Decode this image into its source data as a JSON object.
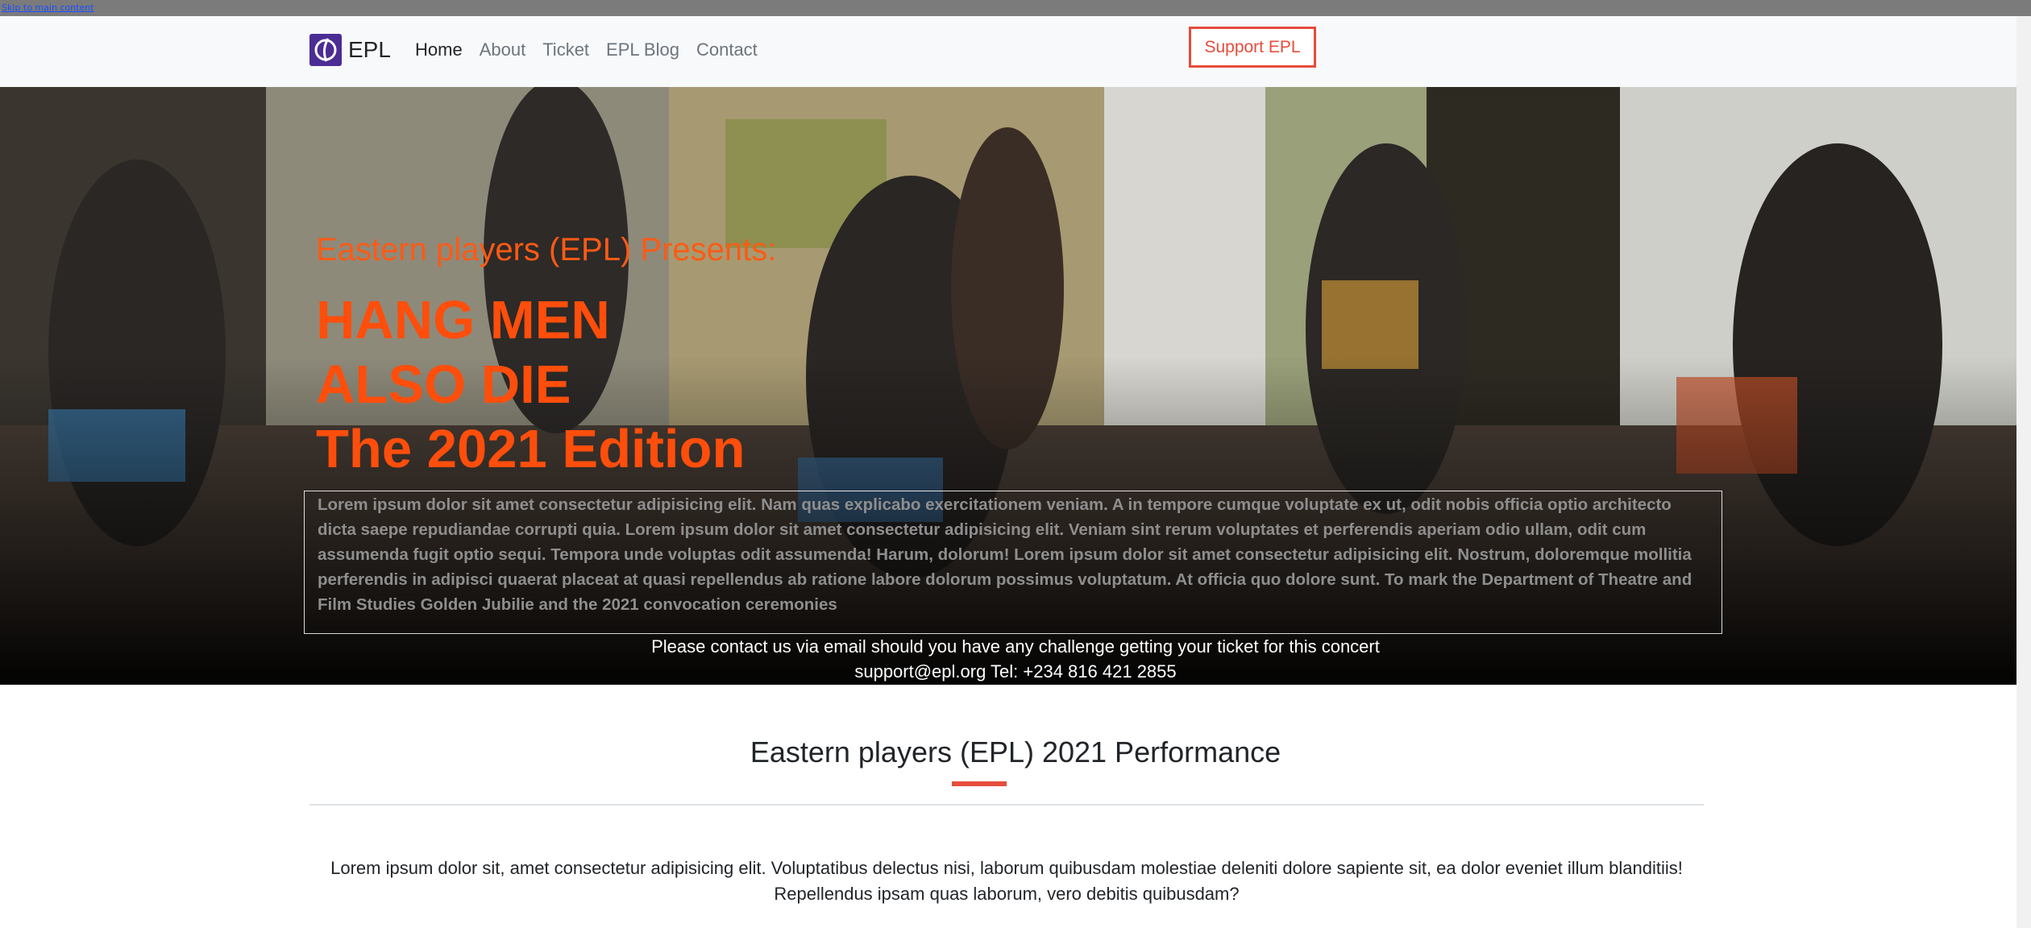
{
  "skip_link": "Skip to main content",
  "nav": {
    "brand": "EPL",
    "links": [
      "Home",
      "About",
      "Ticket",
      "EPL Blog",
      "Contact"
    ],
    "support_label": "Support EPL"
  },
  "hero": {
    "pretitle": "Eastern players (EPL) Presents:",
    "title_lines": [
      "HANG MEN",
      "ALSO DIE",
      "The 2021 Edition"
    ],
    "body": "Lorem ipsum dolor sit amet consectetur adipisicing elit. Nam quas explicabo exercitationem veniam. A in tempore cumque voluptate ex ut, odit nobis officia optio architecto dicta saepe repudiandae corrupti quia. Lorem ipsum dolor sit amet consectetur adipisicing elit. Veniam sint rerum voluptates et perferendis aperiam odio ullam, odit cum assumenda fugit optio sequi. Tempora unde voluptas odit assumenda! Harum, dolorum! Lorem ipsum dolor sit amet consectetur adipisicing elit. Nostrum, doloremque mollitia perferendis in adipisci quaerat placeat at quasi repellendus ab ratione labore dolorum possimus voluptatum. At officia quo dolore sunt. To mark the Department of Theatre and Film Studies Golden Jubilie and the 2021 convocation ceremonies",
    "contact_line1": "Please contact us via email should you have any challenge getting your ticket for this concert",
    "contact_line2": "support@epl.org Tel: +234 816 421 2855"
  },
  "section": {
    "title": "Eastern players (EPL) 2021 Performance",
    "text": "Lorem ipsum dolor sit, amet consectetur adipisicing elit. Voluptatibus delectus nisi, laborum quibusdam molestiae deleniti dolore sapiente sit, ea dolor eveniet illum blanditiis! Repellendus ipsam quas laborum, vero debitis quibusdam?"
  },
  "colors": {
    "accent": "#e74c3c",
    "hero_title": "#ff4e0c",
    "brand_logo": "#4b2d94"
  }
}
